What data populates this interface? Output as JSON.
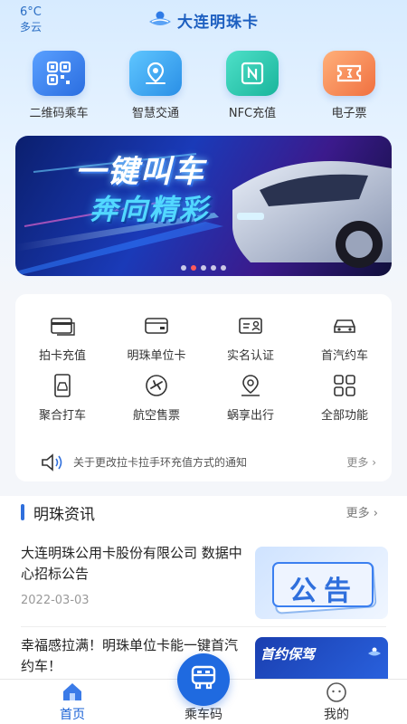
{
  "header": {
    "temperature": "6°C",
    "weather": "多云",
    "app_title": "大连明珠卡"
  },
  "quick_actions": [
    {
      "label": "二维码乘车",
      "icon": "qr-code-icon"
    },
    {
      "label": "智慧交通",
      "icon": "location-pin-icon"
    },
    {
      "label": "NFC充值",
      "icon": "nfc-icon"
    },
    {
      "label": "电子票",
      "icon": "ticket-icon"
    }
  ],
  "banner": {
    "line1": "一键叫车",
    "line2": "奔向精彩",
    "slide_count": 5,
    "active_slide": 2
  },
  "features": [
    {
      "label": "拍卡充值",
      "icon": "card-recharge-icon"
    },
    {
      "label": "明珠单位卡",
      "icon": "wallet-card-icon"
    },
    {
      "label": "实名认证",
      "icon": "id-card-icon"
    },
    {
      "label": "首汽约车",
      "icon": "car-icon"
    },
    {
      "label": "聚合打车",
      "icon": "taxi-phone-icon"
    },
    {
      "label": "航空售票",
      "icon": "airplane-icon"
    },
    {
      "label": "蜗享出行",
      "icon": "map-pin-icon"
    },
    {
      "label": "全部功能",
      "icon": "grid-icon"
    }
  ],
  "notice": {
    "text": "关于更改拉卡拉手环充值方式的通知",
    "more": "更多"
  },
  "news": {
    "title": "明珠资讯",
    "more": "更多",
    "items": [
      {
        "title": "大连明珠公用卡股份有限公司 数据中心招标公告",
        "date": "2022-03-03",
        "thumb_text": "公告"
      },
      {
        "title": "幸福感拉满！明珠单位卡能一键首汽约车！",
        "date": "",
        "thumb_text": "首约保驾"
      }
    ]
  },
  "tabbar": {
    "home": "首页",
    "ride_code": "乘车码",
    "mine": "我的"
  },
  "colors": {
    "primary": "#1f6ae0",
    "accent_red": "#ff5a5a"
  }
}
